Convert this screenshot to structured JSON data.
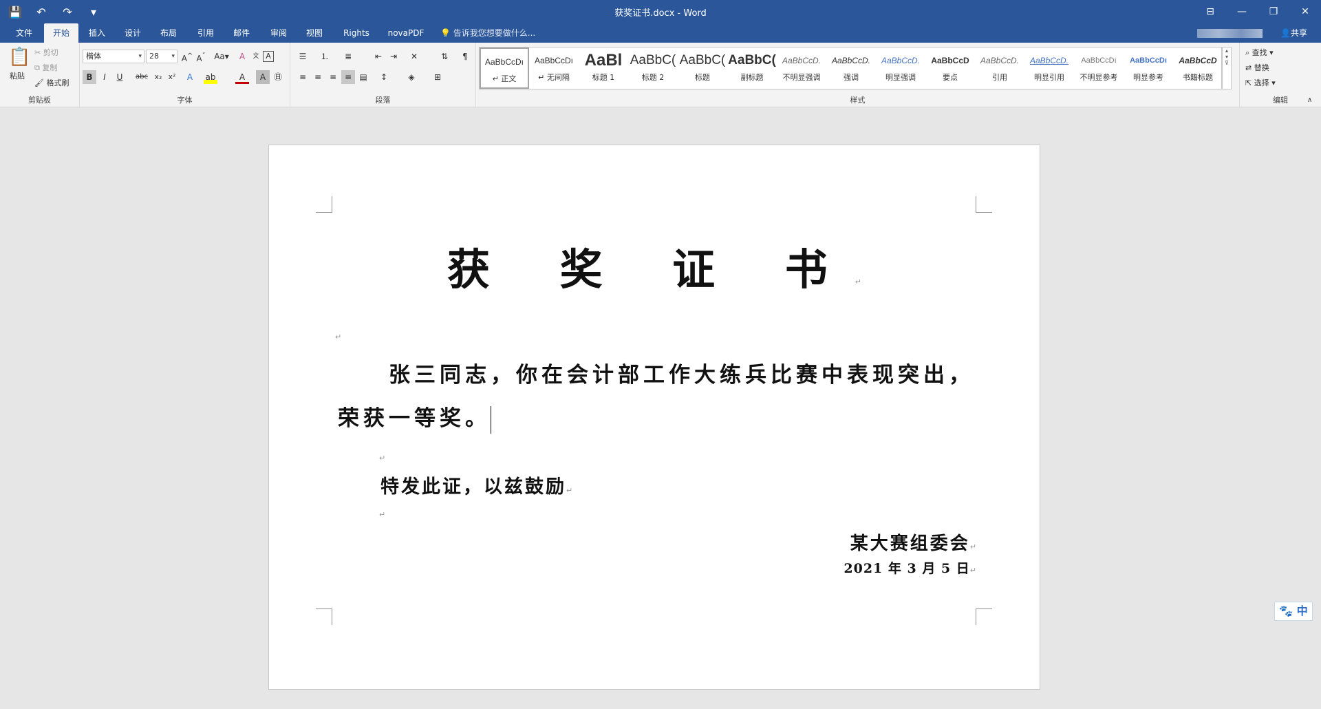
{
  "window": {
    "title": "获奖证书.docx - Word",
    "qat": {
      "save_icon": "💾",
      "undo_icon": "↶",
      "redo_icon": "↷",
      "more_icon": "▾"
    },
    "controls": {
      "ribbon_display": "⊟",
      "minimize": "—",
      "restore": "❐",
      "close": "✕"
    }
  },
  "tabs": [
    "文件",
    "开始",
    "插入",
    "设计",
    "布局",
    "引用",
    "邮件",
    "审阅",
    "视图",
    "Rights",
    "novaPDF"
  ],
  "active_tab": "开始",
  "tell_me": "告诉我您想要做什么...",
  "share": "共享",
  "ribbon": {
    "clipboard": {
      "paste": "粘贴",
      "cut": "剪切",
      "copy": "复制",
      "format_painter": "格式刷",
      "label": "剪贴板"
    },
    "font": {
      "name": "楷体",
      "size": "28",
      "label": "字体"
    },
    "paragraph": {
      "label": "段落"
    },
    "styles": {
      "label": "样式",
      "items": [
        {
          "preview": "AaBbCcDı",
          "name": "↵ 正文"
        },
        {
          "preview": "AaBbCcDı",
          "name": "↵ 无间隔"
        },
        {
          "preview": "AaBl",
          "name": "标题 1"
        },
        {
          "preview": "AaBbC(",
          "name": "标题 2"
        },
        {
          "preview": "AaBbC(",
          "name": "标题"
        },
        {
          "preview": "AaBbC(",
          "name": "副标题"
        },
        {
          "preview": "AaBbCcD.",
          "name": "不明显强调"
        },
        {
          "preview": "AaBbCcD.",
          "name": "强调"
        },
        {
          "preview": "AaBbCcD.",
          "name": "明显强调"
        },
        {
          "preview": "AaBbCcD",
          "name": "要点"
        },
        {
          "preview": "AaBbCcD.",
          "name": "引用"
        },
        {
          "preview": "AaBbCcD.",
          "name": "明显引用"
        },
        {
          "preview": "AaBbCcDı",
          "name": "不明显参考"
        },
        {
          "preview": "AaBbCcDı",
          "name": "明显参考"
        },
        {
          "preview": "AaBbCcD",
          "name": "书籍标题"
        }
      ]
    },
    "editing": {
      "find": "查找",
      "replace": "替换",
      "select": "选择",
      "label": "编辑"
    }
  },
  "document": {
    "heading": "获 奖 证 书",
    "body": "张三同志，你在会计部工作大练兵比赛中表现突出，荣获一等奖。",
    "closing": "特发此证，以兹鼓励",
    "organizer": "某大赛组委会",
    "date": "2021 年 3 月 5 日",
    "para_mark": "↵"
  },
  "ime": "🐾 中"
}
